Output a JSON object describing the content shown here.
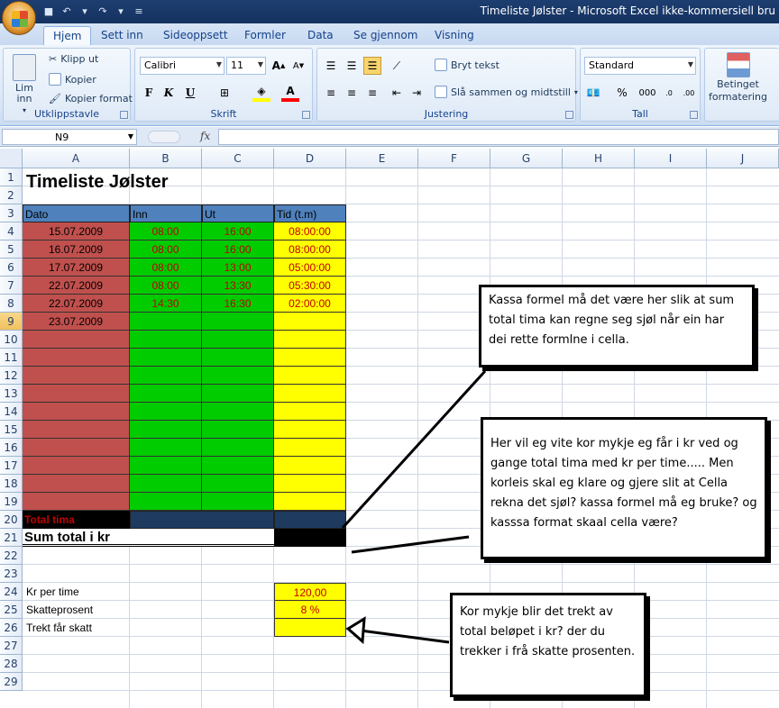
{
  "window": {
    "title": "Timeliste Jølster - Microsoft Excel ikke-kommersiell bru"
  },
  "tabs": [
    "Hjem",
    "Sett inn",
    "Sideoppsett",
    "Formler",
    "Data",
    "Se gjennom",
    "Visning"
  ],
  "ribbon": {
    "clipboard": {
      "label": "Utklippstavle",
      "paste": "Lim inn",
      "paste_arrow": "▾",
      "cut": "Klipp ut",
      "copy": "Kopier",
      "format_painter": "Kopier format"
    },
    "font": {
      "label": "Skrift",
      "font_name": "Calibri",
      "font_size": "11",
      "bold": "F",
      "italic": "K",
      "underline": "U"
    },
    "alignment": {
      "label": "Justering",
      "wrap_text": "Bryt tekst",
      "merge_center": "Slå sammen og midtstill"
    },
    "number": {
      "label": "Tall",
      "format": "Standard",
      "percent": "%",
      "thousands": "000"
    },
    "styles": {
      "conditional_line1": "Betinget",
      "conditional_line2": "formatering"
    }
  },
  "formula_bar": {
    "name_box": "N9",
    "fx": "fx",
    "formula": ""
  },
  "columns": [
    "A",
    "B",
    "C",
    "D",
    "E",
    "F",
    "G",
    "H",
    "I",
    "J"
  ],
  "rows": [
    "1",
    "2",
    "3",
    "4",
    "5",
    "6",
    "7",
    "8",
    "9",
    "10",
    "11",
    "12",
    "13",
    "14",
    "15",
    "16",
    "17",
    "18",
    "19",
    "20",
    "21",
    "22",
    "23",
    "24",
    "25",
    "26",
    "27",
    "28",
    "29"
  ],
  "sheet": {
    "title": "Timeliste Jølster",
    "headers": {
      "a": "Dato",
      "b": "Inn",
      "c": "Ut",
      "d": "Tid (t.m)"
    },
    "entries": [
      {
        "date": "15.07.2009",
        "in": "08:00",
        "out": "16:00",
        "time": "08:00:00"
      },
      {
        "date": "16.07.2009",
        "in": "08:00",
        "out": "16:00",
        "time": "08:00:00"
      },
      {
        "date": "17.07.2009",
        "in": "08:00",
        "out": "13:00",
        "time": "05:00:00"
      },
      {
        "date": "22.07.2009",
        "in": "08:00",
        "out": "13:30",
        "time": "05:30:00"
      },
      {
        "date": "22.07.2009",
        "in": "14:30",
        "out": "16:30",
        "time": "02:00:00"
      },
      {
        "date": "23.07.2009",
        "in": "",
        "out": "",
        "time": ""
      }
    ],
    "total_label": "Total tima",
    "sum_label": "Sum total i kr",
    "kr_label": "Kr per time",
    "kr_value": "120,00",
    "tax_label": "Skatteprosent",
    "tax_value": "8 %",
    "deduct_label": "Trekt får skatt"
  },
  "notes": {
    "n1": "Kassa formel må det være her slik at sum total tima kan regne seg sjøl når ein har dei rette formlne i cella.",
    "n2": "Her vil eg vite kor mykje eg får i kr ved og gange total tima med kr per time..... Men korleis skal eg klare og gjere slit at Cella rekna det sjøl? kassa formel må eg bruke? og kasssa format skaal cella være?",
    "n3": "Kor mykje blir det trekt av total beløpet i kr? der du trekker i frå skatte prosenten."
  },
  "colors": {
    "red": "#c0504d",
    "green": "#00cc00",
    "yellow": "#ffff00",
    "header_blue": "#4f81bd",
    "navy": "#1f3a5f"
  }
}
